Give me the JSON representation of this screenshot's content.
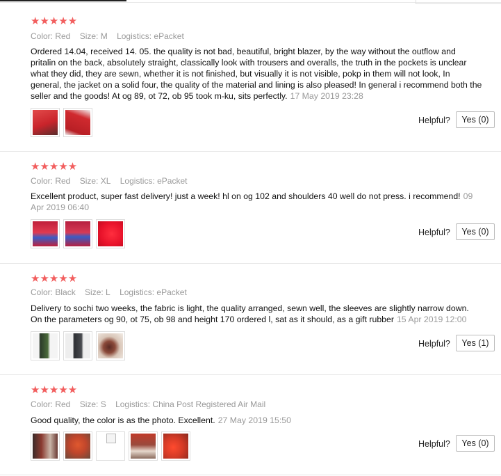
{
  "reviews": [
    {
      "stars": "★★★★★",
      "color": "Color: Red",
      "size": "Size: M",
      "logistics": "Logistics: ePacket",
      "text": "Ordered 14.04, received 14. 05. the quality is not bad, beautiful, bright blazer, by the way without the outflow and pritalin on the back, absolutely straight, classically look with trousers and overalls, the truth in the pockets is unclear what they did, they are sewn, whether it is not finished, but visually it is not visible, pokp in them will not look, In general, the jacket on a solid four, the quality of the material and lining is also pleased! In general i recommend both the seller and the goods! At og 89, ot 72, ob 95 took m-ku, sits perfectly.",
      "date": "17 May 2019 23:28",
      "helpful_label": "Helpful?",
      "yes_label": "Yes (0)",
      "thumb_colors": [
        "#c9242b",
        "#d02a2f"
      ]
    },
    {
      "stars": "★★★★★",
      "color": "Color: Red",
      "size": "Size: XL",
      "logistics": "Logistics: ePacket",
      "text": "Excellent product, super fast delivery! just a week! hl on og 102 and shoulders 40 well do not press. i recommend!",
      "date": "09 Apr 2019 06:40",
      "helpful_label": "Helpful?",
      "yes_label": "Yes (0)",
      "thumb_colors": [
        "#c01f3a",
        "#b72040",
        "#e8122a"
      ]
    },
    {
      "stars": "★★★★★",
      "color": "Color: Black",
      "size": "Size: L",
      "logistics": "Logistics: ePacket",
      "text": "Delivery to sochi two weeks, the fabric is light, the quality arranged, sewn well, the sleeves are slightly narrow down. On the parameters og 90, ot 75, ob 98 and height 170 ordered l, sat as it should, as a gift rubber",
      "date": "15 Apr 2019 12:00",
      "helpful_label": "Helpful?",
      "yes_label": "Yes (1)",
      "thumb_colors": [
        "#2b3a2a",
        "#2d2f33",
        "#8b4a3a"
      ]
    },
    {
      "stars": "★★★★★",
      "color": "Color: Red",
      "size": "Size: S",
      "logistics": "Logistics: China Post Registered Air Mail",
      "text": "Good quality, the color is as the photo. Excellent.",
      "date": "27 May 2019 15:50",
      "helpful_label": "Helpful?",
      "yes_label": "Yes (0)",
      "thumb_colors": [
        "#8a3a30",
        "#c0462c",
        "broken",
        "#9a4a3c",
        "#d23a26"
      ]
    }
  ]
}
